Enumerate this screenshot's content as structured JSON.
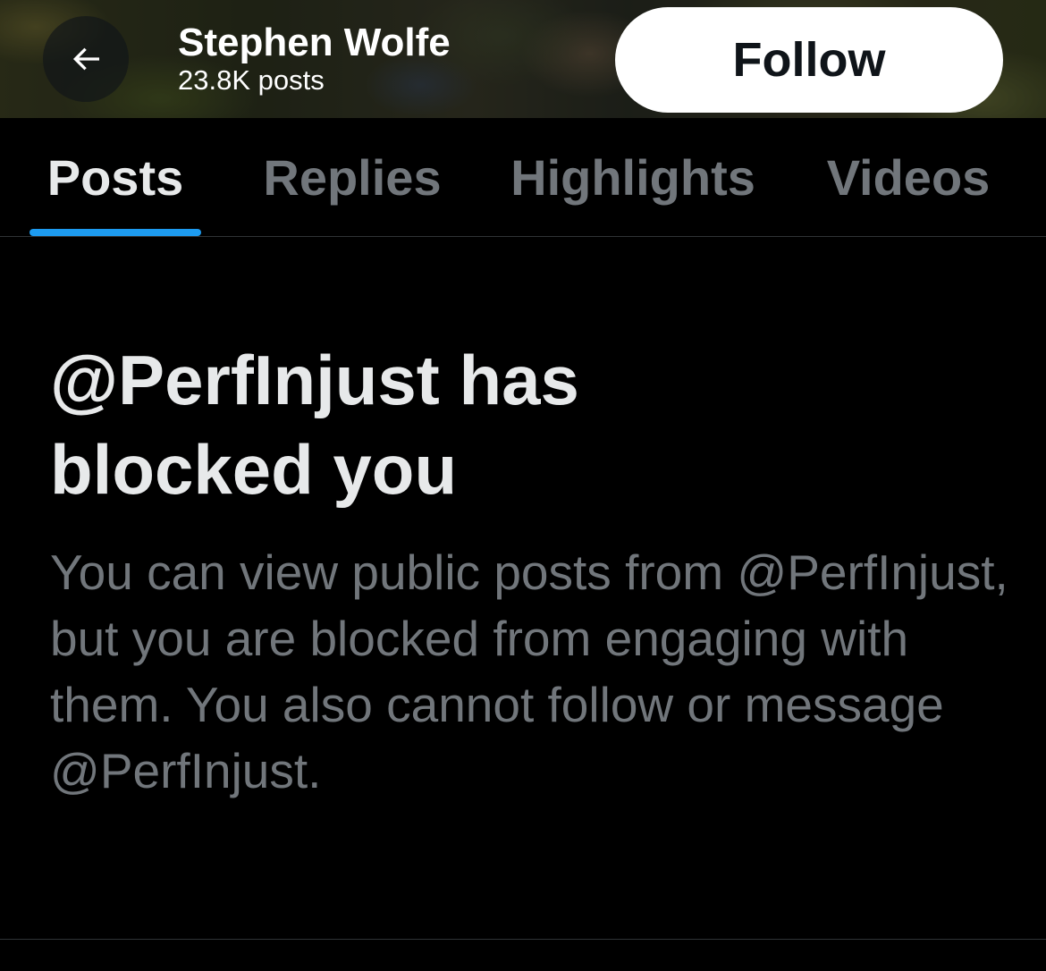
{
  "header": {
    "profile_name": "Stephen Wolfe",
    "post_count": "23.8K posts",
    "follow_label": "Follow",
    "back_icon": "arrow-left-icon"
  },
  "tabs": [
    {
      "label": "Posts",
      "active": true
    },
    {
      "label": "Replies",
      "active": false
    },
    {
      "label": "Highlights",
      "active": false
    },
    {
      "label": "Videos",
      "active": false
    }
  ],
  "blocked": {
    "heading": "@PerfInjust has blocked you",
    "body": "You can view public posts from @PerfInjust, but you are blocked from engaging with them. You also cannot follow or message @PerfInjust."
  },
  "colors": {
    "background": "#000000",
    "primary_text": "#e7e9ea",
    "secondary_text": "#71767b",
    "accent": "#1d9bf0",
    "follow_button_bg": "#ffffff",
    "follow_button_text": "#0f1419",
    "divider": "#2f3336"
  }
}
